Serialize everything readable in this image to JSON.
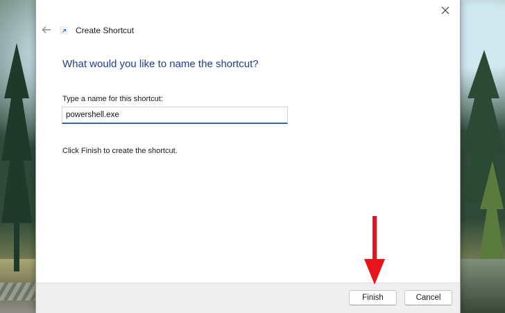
{
  "dialog": {
    "title": "Create Shortcut",
    "heading": "What would you like to name the shortcut?",
    "field_label": "Type a name for this shortcut:",
    "name_value": "powershell.exe",
    "hint": "Click Finish to create the shortcut.",
    "finish_label": "Finish",
    "cancel_label": "Cancel"
  },
  "icons": {
    "close": "close-icon",
    "back": "back-arrow-icon",
    "title": "shortcut-icon"
  },
  "colors": {
    "heading": "#1c3e8e",
    "input_focus": "#2f63b5",
    "annotation_arrow": "#e8131b"
  }
}
